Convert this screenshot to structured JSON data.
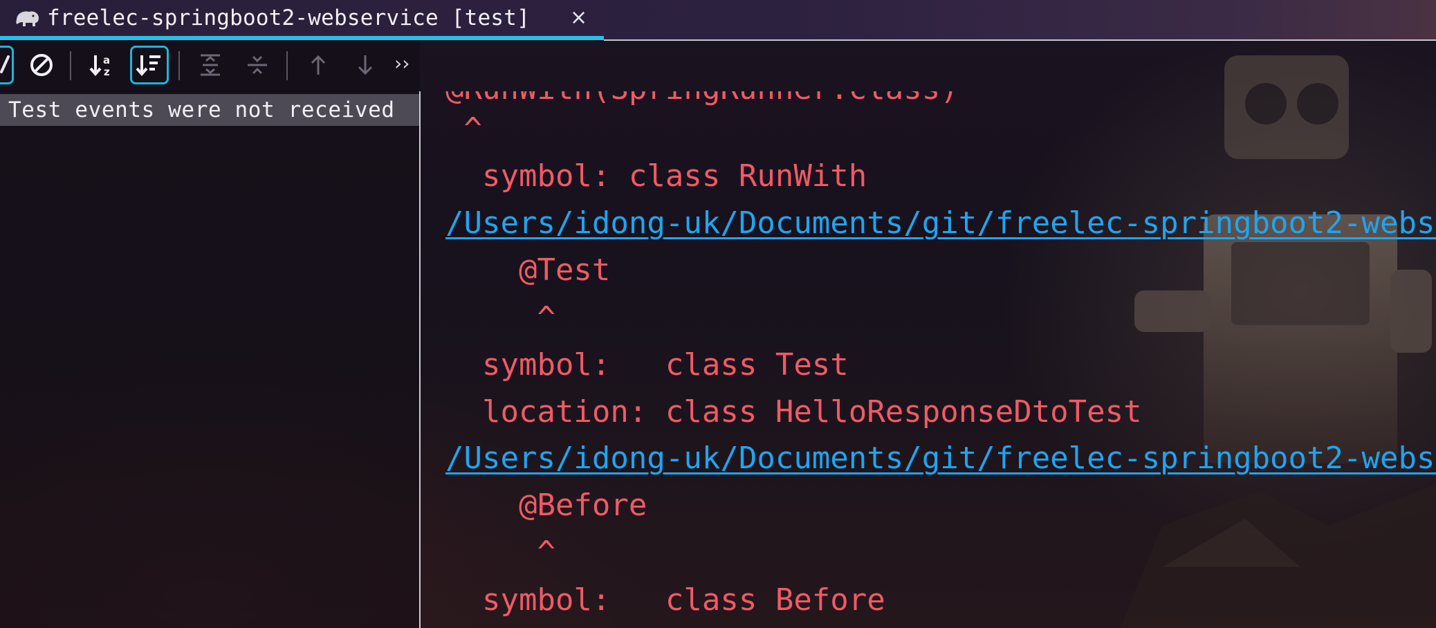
{
  "tab": {
    "title": "freelec-springboot2-webservice [test]",
    "close_glyph": "×",
    "icon": "gradle-elephant-icon"
  },
  "toolbar": {
    "buttons": [
      {
        "name": "show-passed-icon"
      },
      {
        "name": "show-ignored-icon"
      },
      {
        "name": "sort-alphabetically-icon"
      },
      {
        "name": "sort-by-duration-icon",
        "selected": true
      },
      {
        "name": "expand-all-icon"
      },
      {
        "name": "collapse-all-icon"
      },
      {
        "name": "previous-failed-icon"
      },
      {
        "name": "next-failed-icon"
      }
    ],
    "more_glyph": "››"
  },
  "tree": {
    "selected_label": "Test events were not received"
  },
  "console": {
    "lines": [
      "@RunWith(SpringRunner.class)",
      " ^",
      "  symbol: class RunWith",
      "/Users/idong-uk/Documents/git/freelec-springboot2-webse",
      "    @Test",
      "     ^",
      "  symbol:   class Test",
      "  location: class HelloResponseDtoTest",
      "/Users/idong-uk/Documents/git/freelec-springboot2-webse",
      "    @Before",
      "     ^",
      "  symbol:   class Before"
    ]
  },
  "colors": {
    "accent": "#26c1e6",
    "error_text": "#f05a66",
    "link": "#1fa5f0"
  }
}
